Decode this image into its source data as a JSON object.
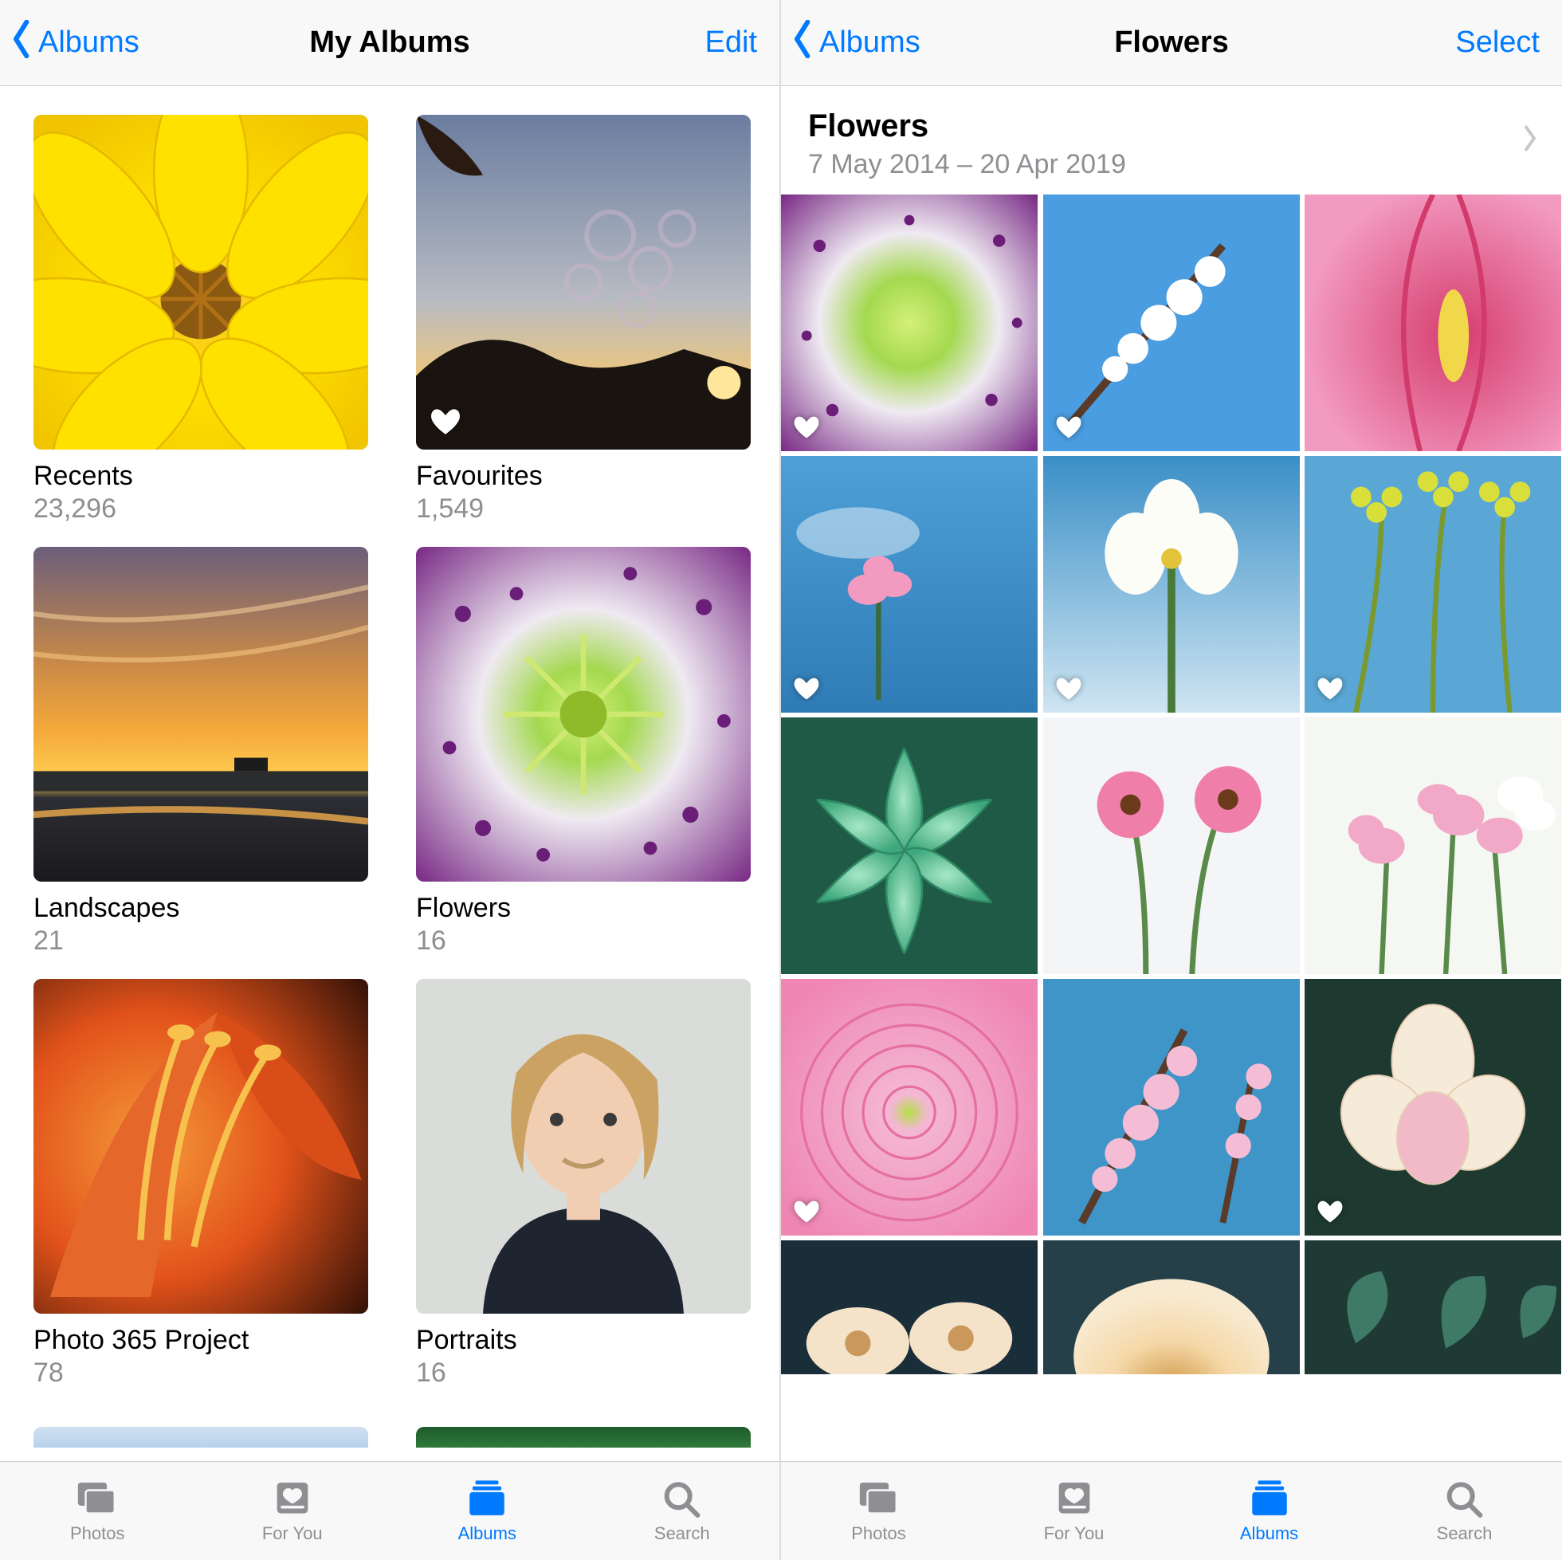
{
  "left": {
    "nav": {
      "back": "Albums",
      "title": "My Albums",
      "right": "Edit"
    },
    "albums": [
      {
        "title": "Recents",
        "count": "23,296",
        "favorite": false
      },
      {
        "title": "Favourites",
        "count": "1,549",
        "favorite": true
      },
      {
        "title": "Landscapes",
        "count": "21",
        "favorite": false
      },
      {
        "title": "Flowers",
        "count": "16",
        "favorite": false
      },
      {
        "title": "Photo 365 Project",
        "count": "78",
        "favorite": false
      },
      {
        "title": "Portraits",
        "count": "16",
        "favorite": false
      }
    ],
    "tabs": [
      {
        "label": "Photos",
        "icon": "photos",
        "active": false
      },
      {
        "label": "For You",
        "icon": "foryou",
        "active": false
      },
      {
        "label": "Albums",
        "icon": "albums",
        "active": true
      },
      {
        "label": "Search",
        "icon": "search",
        "active": false
      }
    ]
  },
  "right": {
    "nav": {
      "back": "Albums",
      "title": "Flowers",
      "right": "Select"
    },
    "header": {
      "title": "Flowers",
      "dates": "7 May 2014 – 20 Apr 2019"
    },
    "photos": [
      {
        "favorite": true
      },
      {
        "favorite": true
      },
      {
        "favorite": false
      },
      {
        "favorite": true
      },
      {
        "favorite": true
      },
      {
        "favorite": true
      },
      {
        "favorite": false
      },
      {
        "favorite": false
      },
      {
        "favorite": false
      },
      {
        "favorite": true
      },
      {
        "favorite": false
      },
      {
        "favorite": true
      },
      {
        "favorite": false
      },
      {
        "favorite": false
      },
      {
        "favorite": false
      }
    ],
    "tabs": [
      {
        "label": "Photos",
        "icon": "photos",
        "active": false
      },
      {
        "label": "For You",
        "icon": "foryou",
        "active": false
      },
      {
        "label": "Albums",
        "icon": "albums",
        "active": true
      },
      {
        "label": "Search",
        "icon": "search",
        "active": false
      }
    ]
  }
}
